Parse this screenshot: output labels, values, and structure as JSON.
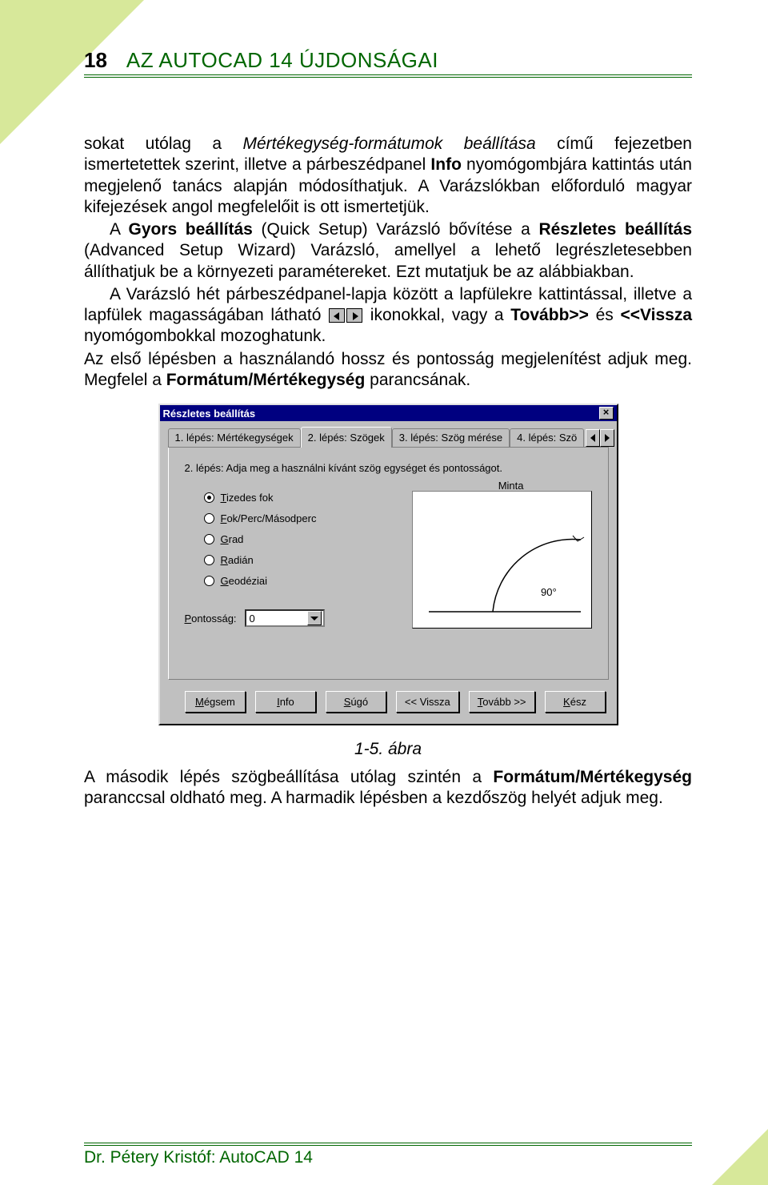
{
  "header": {
    "page_number": "18",
    "title": "AZ AUTOCAD 14 ÚJDONSÁGAI"
  },
  "paragraphs": {
    "p1a": "sokat utólag a ",
    "p1b": "Mértékegység-formátumok beállítása",
    "p1c": " című fejezetben ismertetettek szerint, illetve a párbeszédpanel ",
    "p1d": "Info",
    "p1e": " nyomógombjára kattintás után megjelenő tanács alapján módosíthatjuk. A Varázslókban előforduló magyar kifejezések angol megfelelőit is ott ismertetjük.",
    "p2a": "A ",
    "p2b": "Gyors beállítás",
    "p2c": " (Quick Setup) Varázsló bővítése a ",
    "p2d": "Részletes beállítás",
    "p2e": " (Advanced Setup Wizard) Varázsló, amellyel a lehető legrészletesebben állíthatjuk be a környezeti paramétereket. Ezt mutatjuk be az alábbiakban.",
    "p3a": "A Varázsló hét párbeszédpanel-lapja között a lapfülekre kattintással, illetve a lapfülek magasságában látható ",
    "p3b": " ikonokkal, vagy a ",
    "p3c": "Tovább>>",
    "p3d": " és ",
    "p3e": "<<Vissza",
    "p3f": " nyomógombokkal mozoghatunk.",
    "p4a": "Az első lépésben a használandó hossz és pontosság megjelenítést adjuk meg. Megfelel a ",
    "p4b": "Formátum/Mértékegység",
    "p4c": " parancsának.",
    "p5a": "A második lépés szögbeállítása utólag szintén a ",
    "p5b": "Formátum/Mértékegység",
    "p5c": " paranccsal oldható meg. A harmadik lépésben a kezdőszög helyét adjuk meg."
  },
  "caption": "1-5. ábra",
  "dialog": {
    "title": "Részletes beállítás",
    "tabs": [
      "1. lépés: Mértékegységek",
      "2. lépés: Szögek",
      "3. lépés: Szög mérése",
      "4. lépés: Szö"
    ],
    "active_tab": 1,
    "instruction": "2. lépés: Adja meg a használni kívánt szög egységet és pontosságot.",
    "radios": [
      {
        "label_pre": "T",
        "label": "izedes fok",
        "selected": true
      },
      {
        "label_pre": "F",
        "label": "ok/Perc/Másodperc",
        "selected": false
      },
      {
        "label_pre": "G",
        "label": "rad",
        "selected": false
      },
      {
        "label_pre": "R",
        "label": "adián",
        "selected": false
      },
      {
        "label_pre": "G",
        "label": "eodéziai",
        "selected": false
      }
    ],
    "sample_label": "Minta",
    "sample_value": "90°",
    "precision_label_pre": "P",
    "precision_label": "ontosság:",
    "precision_value": "0",
    "buttons": {
      "cancel_pre": "M",
      "cancel": "égsem",
      "info_pre": "I",
      "info": "nfo",
      "help_pre": "S",
      "help": "úgó",
      "back": "<< Vissza",
      "back_pre": "V",
      "next_pre": "T",
      "next": "ovább >>",
      "done_pre": "K",
      "done": "ész"
    }
  },
  "footer": "Dr. Pétery Kristóf: AutoCAD 14"
}
